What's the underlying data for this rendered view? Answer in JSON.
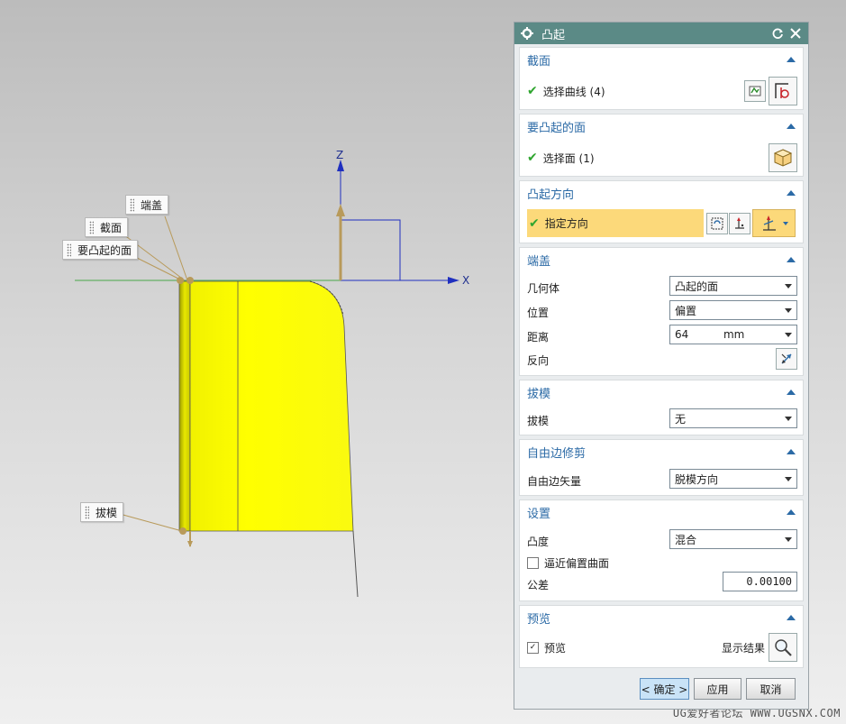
{
  "viewport": {
    "axis_labels": {
      "z": "Z",
      "x": "X"
    },
    "callouts": {
      "end_cap": "端盖",
      "section": "截面",
      "face_to_emboss": "要凸起的面",
      "draft": "拔模"
    },
    "watermark": "UG爱好者论坛 WWW.UGSNX.COM",
    "colors": {
      "part_fill": "#ffff00",
      "axis_x": "#4aa84a",
      "axis_z": "#1f2fbf"
    }
  },
  "dialog": {
    "title": "凸起",
    "sections": {
      "section": {
        "title": "截面",
        "select_label": "选择曲线 (4)"
      },
      "face": {
        "title": "要凸起的面",
        "select_label": "选择面 (1)"
      },
      "direction": {
        "title": "凸起方向",
        "specify_label": "指定方向"
      },
      "end_cap": {
        "title": "端盖",
        "geometry_label": "几何体",
        "geometry_value": "凸起的面",
        "location_label": "位置",
        "location_value": "偏置",
        "distance_label": "距离",
        "distance_value": "64",
        "distance_unit": "mm",
        "reverse_label": "反向"
      },
      "draft": {
        "title": "拔模",
        "draft_label": "拔模",
        "draft_value": "无"
      },
      "free_edge": {
        "title": "自由边修剪",
        "vector_label": "自由边矢量",
        "vector_value": "脱模方向"
      },
      "settings": {
        "title": "设置",
        "convexity_label": "凸度",
        "convexity_value": "混合",
        "approx_label": "逼近偏置曲面",
        "approx_checked": false,
        "tolerance_label": "公差",
        "tolerance_value": "0.00100"
      },
      "preview": {
        "title": "预览",
        "preview_label": "预览",
        "preview_checked": true,
        "show_result_label": "显示结果"
      }
    },
    "buttons": {
      "ok": "< 确定 >",
      "apply": "应用",
      "cancel": "取消"
    },
    "colors": {
      "titlebar": "#5b8a86",
      "section_title": "#2b6aa6",
      "highlight": "#fcd97a",
      "ok_button": "#c9e3f7"
    }
  }
}
